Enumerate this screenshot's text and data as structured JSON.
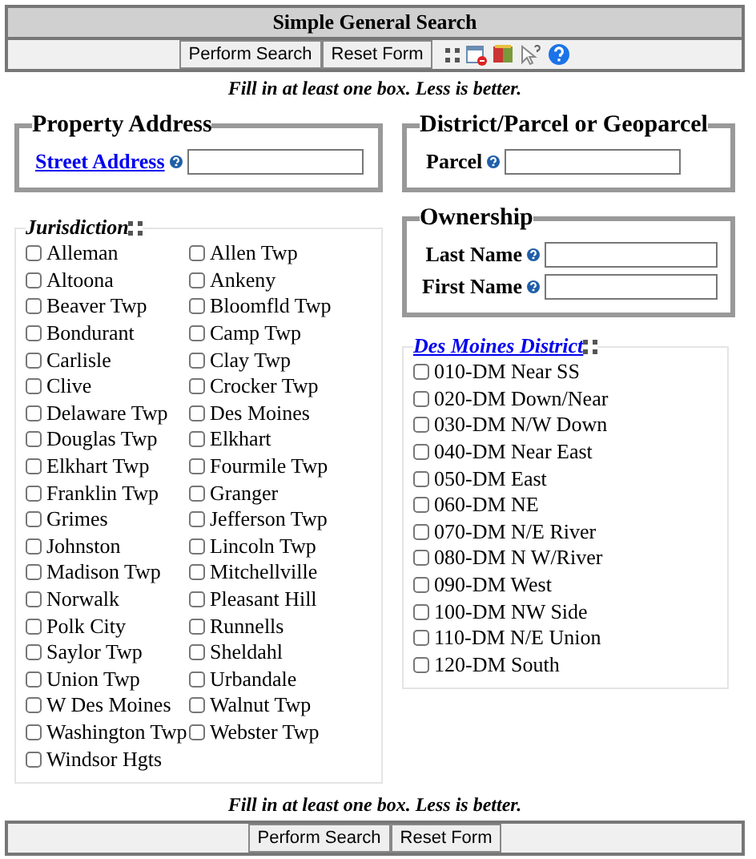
{
  "title": "Simple General Search",
  "toolbar": {
    "buttons": [
      "Perform Search",
      "Reset Form"
    ]
  },
  "hint_top": "Fill in at least one box. Less is better.",
  "property_address": {
    "legend": "Property Address",
    "field_label": "Street Address"
  },
  "district_parcel": {
    "legend": "District/Parcel or Geoparcel",
    "field_label": "Parcel"
  },
  "ownership": {
    "legend": "Ownership",
    "fields": [
      "Last Name",
      "First Name"
    ]
  },
  "jurisdiction": {
    "legend": "Jurisdiction",
    "items": [
      {
        "label": "Alleman",
        "checked": false
      },
      {
        "label": "Allen Twp",
        "checked": false
      },
      {
        "label": "Altoona",
        "checked": false
      },
      {
        "label": "Ankeny",
        "checked": false
      },
      {
        "label": "Beaver Twp",
        "checked": false
      },
      {
        "label": "Bloomfld Twp",
        "checked": false
      },
      {
        "label": "Bondurant",
        "checked": false
      },
      {
        "label": "Camp Twp",
        "checked": false
      },
      {
        "label": "Carlisle",
        "checked": false
      },
      {
        "label": "Clay Twp",
        "checked": false
      },
      {
        "label": "Clive",
        "checked": false
      },
      {
        "label": "Crocker Twp",
        "checked": false
      },
      {
        "label": "Delaware Twp",
        "checked": false
      },
      {
        "label": "Des Moines",
        "checked": false
      },
      {
        "label": "Douglas Twp",
        "checked": false
      },
      {
        "label": "Elkhart",
        "checked": false
      },
      {
        "label": "Elkhart Twp",
        "checked": false
      },
      {
        "label": "Fourmile Twp",
        "checked": false
      },
      {
        "label": "Franklin Twp",
        "checked": false
      },
      {
        "label": "Granger",
        "checked": false
      },
      {
        "label": "Grimes",
        "checked": false
      },
      {
        "label": "Jefferson Twp",
        "checked": false
      },
      {
        "label": "Johnston",
        "checked": false
      },
      {
        "label": "Lincoln Twp",
        "checked": false
      },
      {
        "label": "Madison Twp",
        "checked": false
      },
      {
        "label": "Mitchellville",
        "checked": false
      },
      {
        "label": "Norwalk",
        "checked": false
      },
      {
        "label": "Pleasant Hill",
        "checked": false
      },
      {
        "label": "Polk City",
        "checked": false
      },
      {
        "label": "Runnells",
        "checked": false
      },
      {
        "label": "Saylor Twp",
        "checked": false
      },
      {
        "label": "Sheldahl",
        "checked": false
      },
      {
        "label": "Union Twp",
        "checked": false
      },
      {
        "label": "Urbandale",
        "checked": false
      },
      {
        "label": "W Des Moines",
        "checked": false
      },
      {
        "label": "Walnut Twp",
        "checked": false
      },
      {
        "label": "Washington Twp",
        "checked": false
      },
      {
        "label": "Webster Twp",
        "checked": false
      },
      {
        "label": "Windsor Hgts",
        "checked": false
      }
    ]
  },
  "des_moines_district": {
    "legend": "Des Moines District",
    "items": [
      {
        "label": "010-DM Near SS",
        "checked": false
      },
      {
        "label": "020-DM Down/Near",
        "checked": false
      },
      {
        "label": "030-DM N/W Down",
        "checked": false
      },
      {
        "label": "040-DM Near East",
        "checked": false
      },
      {
        "label": "050-DM East",
        "checked": false
      },
      {
        "label": "060-DM NE",
        "checked": false
      },
      {
        "label": "070-DM N/E River",
        "checked": false
      },
      {
        "label": "080-DM N W/River",
        "checked": false
      },
      {
        "label": "090-DM West",
        "checked": false
      },
      {
        "label": "100-DM NW Side",
        "checked": false
      },
      {
        "label": "110-DM N/E Union",
        "checked": false
      },
      {
        "label": "120-DM South",
        "checked": false
      }
    ]
  },
  "hint_bottom": "Fill in at least one box. Less is better.",
  "bottom_bar": {
    "buttons": [
      "Perform Search",
      "Reset Form"
    ]
  }
}
